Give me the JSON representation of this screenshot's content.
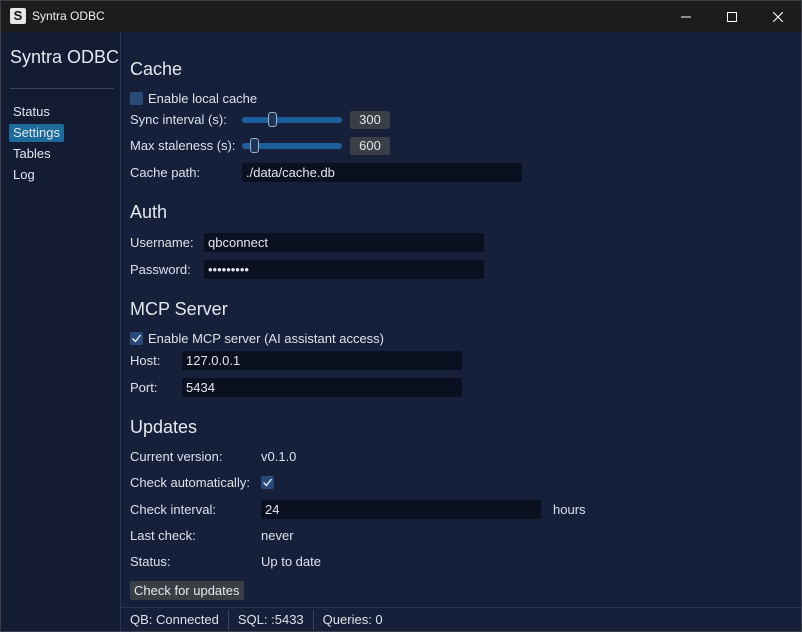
{
  "window": {
    "title": "Syntra ODBC"
  },
  "sidebar": {
    "brand": "Syntra ODBC",
    "items": [
      {
        "label": "Status",
        "active": false
      },
      {
        "label": "Settings",
        "active": true
      },
      {
        "label": "Tables",
        "active": false
      },
      {
        "label": "Log",
        "active": false
      }
    ]
  },
  "cache": {
    "title": "Cache",
    "enable_label": "Enable local cache",
    "enabled": false,
    "sync_label": "Sync interval (s):",
    "sync_value": "300",
    "sync_fraction": 0.29,
    "stale_label": "Max staleness (s):",
    "stale_value": "600",
    "stale_fraction": 0.09,
    "path_label": "Cache path:",
    "path_value": "./data/cache.db"
  },
  "auth": {
    "title": "Auth",
    "username_label": "Username:",
    "username_value": "qbconnect",
    "password_label": "Password:",
    "password_value": "•••••••••"
  },
  "mcp": {
    "title": "MCP Server",
    "enable_label": "Enable MCP server (AI assistant access)",
    "enabled": true,
    "host_label": "Host:",
    "host_value": "127.0.0.1",
    "port_label": "Port:",
    "port_value": "5434"
  },
  "updates": {
    "title": "Updates",
    "current_label": "Current version:",
    "current_value": "v0.1.0",
    "auto_label": "Check automatically:",
    "auto_enabled": true,
    "interval_label": "Check interval:",
    "interval_value": "24",
    "interval_unit": "hours",
    "last_label": "Last check:",
    "last_value": "never",
    "status_label": "Status:",
    "status_value": "Up to date",
    "check_button": "Check for updates"
  },
  "statusbar": {
    "qb": "QB: Connected",
    "sql": "SQL: :5433",
    "queries": "Queries: 0"
  },
  "colors": {
    "accent": "#1d6b9a",
    "background": "#16203a",
    "slider": "#1e5e9c"
  }
}
